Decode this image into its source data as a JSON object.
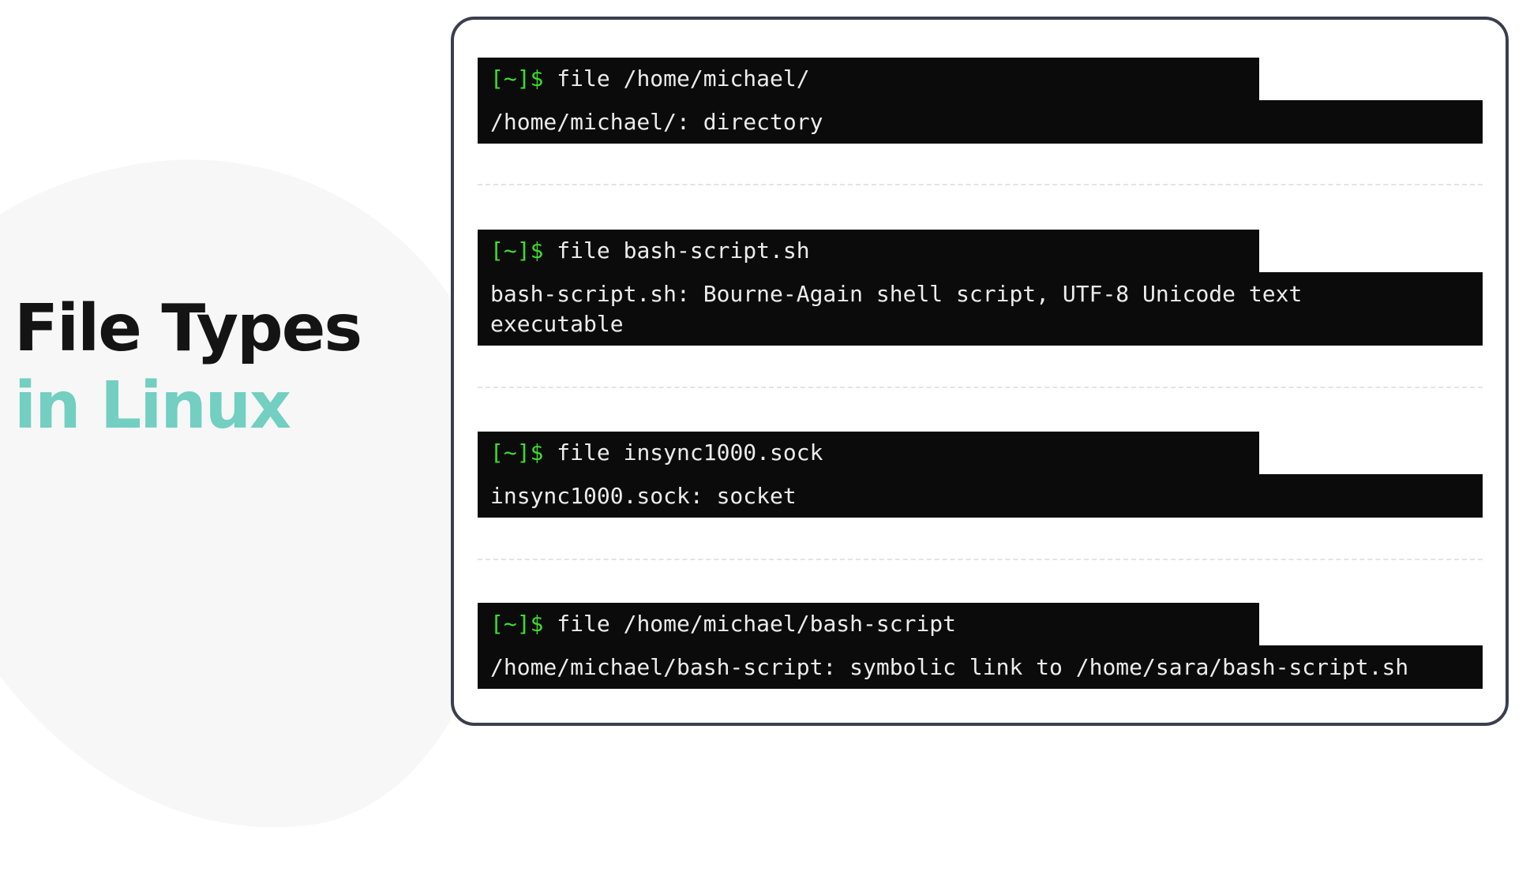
{
  "heading": {
    "line1": "File Types",
    "line2": "in Linux"
  },
  "colors": {
    "title_dark": "#141414",
    "title_accent": "#72cfc1",
    "prompt_green": "#3cdf2a",
    "terminal_bg": "#0b0b0b",
    "panel_border": "#3a3e4d"
  },
  "examples": [
    {
      "prompt": "[~]$",
      "command": "file /home/michael/",
      "output": "/home/michael/: directory"
    },
    {
      "prompt": "[~]$",
      "command": "file bash-script.sh",
      "output": "bash-script.sh: Bourne-Again shell script, UTF-8 Unicode text executable"
    },
    {
      "prompt": "[~]$",
      "command": "file insync1000.sock",
      "output": "insync1000.sock: socket"
    },
    {
      "prompt": "[~]$",
      "command": "file /home/michael/bash-script",
      "output": "/home/michael/bash-script: symbolic link to /home/sara/bash-script.sh"
    }
  ]
}
